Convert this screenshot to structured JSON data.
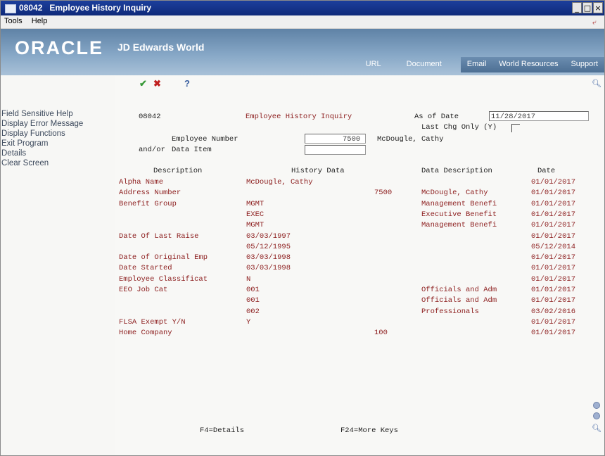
{
  "window": {
    "title": "08042   Employee History Inquiry"
  },
  "menubar": {
    "tools": "Tools",
    "help": "Help"
  },
  "banner": {
    "brand": "ORACLE",
    "product": "JD Edwards World",
    "tabs": [
      "URL",
      "Document",
      "Email",
      "World Resources",
      "Support"
    ]
  },
  "sidebar": {
    "items": [
      "Field Sensitive Help",
      "Display Error Message",
      "Display Functions",
      "Exit Program",
      "Details",
      "Clear Screen"
    ]
  },
  "toolbar": {
    "ok": "✔",
    "cancel": "✖",
    "help": "?"
  },
  "form": {
    "program_id": "08042",
    "form_title": "Employee History Inquiry",
    "as_of_date_label": "As of Date",
    "as_of_date_value": "11/28/2017",
    "last_chg_label": "Last Chg Only (Y)",
    "employee_number_label": "Employee Number",
    "employee_number_value": "7500",
    "employee_name": "McDougle, Cathy",
    "and_or": "and/or",
    "data_item_label": "Data Item"
  },
  "grid": {
    "headers": [
      "Description",
      "History Data",
      "Data Description",
      "Date"
    ],
    "rows": [
      {
        "desc": "Alpha Name",
        "history": "McDougle, Cathy",
        "data_desc": "",
        "date": "01/01/2017"
      },
      {
        "desc": "Address Number",
        "history": "7500",
        "data_desc": "McDougle, Cathy",
        "date": "01/01/2017"
      },
      {
        "desc": "Benefit Group",
        "history": "MGMT",
        "data_desc": "Management Benefi",
        "date": "01/01/2017"
      },
      {
        "desc": "",
        "history": "EXEC",
        "data_desc": "Executive Benefit",
        "date": "01/01/2017"
      },
      {
        "desc": "",
        "history": "MGMT",
        "data_desc": "Management Benefi",
        "date": "01/01/2017"
      },
      {
        "desc": "Date Of Last Raise",
        "history": "03/03/1997",
        "data_desc": "",
        "date": "01/01/2017"
      },
      {
        "desc": "",
        "history": "05/12/1995",
        "data_desc": "",
        "date": "05/12/2014"
      },
      {
        "desc": "Date of Original Emp",
        "history": "03/03/1998",
        "data_desc": "",
        "date": "01/01/2017"
      },
      {
        "desc": "Date Started",
        "history": "03/03/1998",
        "data_desc": "",
        "date": "01/01/2017"
      },
      {
        "desc": "Employee Classificat",
        "history": "N",
        "data_desc": "",
        "date": "01/01/2017"
      },
      {
        "desc": "EEO Job Cat",
        "history": "001",
        "data_desc": "Officials and Adm",
        "date": "01/01/2017"
      },
      {
        "desc": "",
        "history": "001",
        "data_desc": "Officials and Adm",
        "date": "01/01/2017"
      },
      {
        "desc": "",
        "history": "002",
        "data_desc": "Professionals",
        "date": "03/02/2016"
      },
      {
        "desc": "FLSA Exempt Y/N",
        "history": "Y",
        "data_desc": "",
        "date": "01/01/2017"
      },
      {
        "desc": "Home Company",
        "history": "100",
        "data_desc": "",
        "date": "01/01/2017"
      }
    ]
  },
  "footer": {
    "f4": "F4=Details",
    "f24": "F24=More Keys"
  },
  "colors": {
    "accent_red": "#8c1d1d",
    "titlebar": "#0f2a7a"
  }
}
